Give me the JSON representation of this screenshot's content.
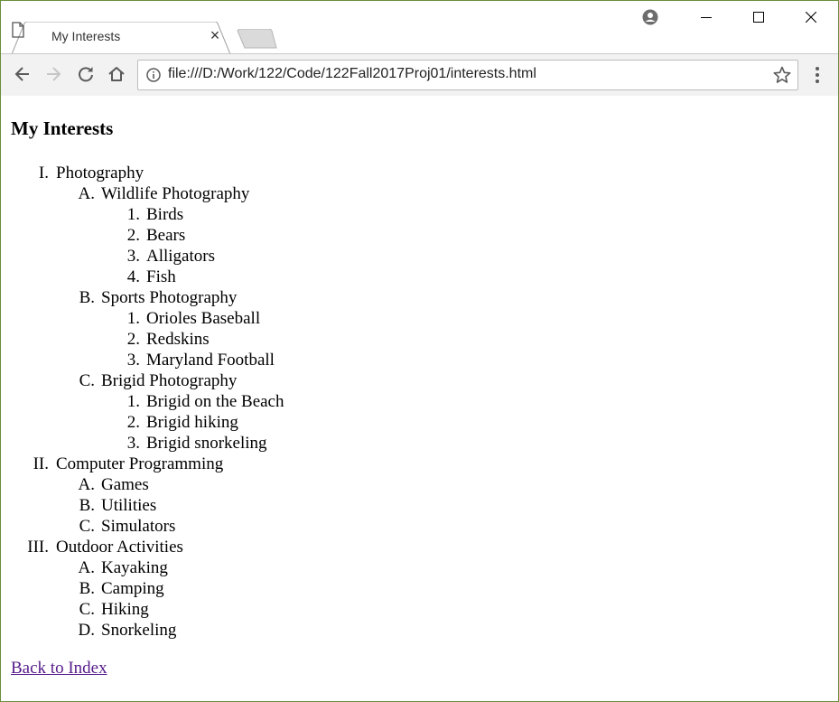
{
  "tab": {
    "title": "My Interests",
    "close_glyph": "×"
  },
  "address_bar": {
    "url": "file:///D:/Work/122/Code/122Fall2017Proj01/interests.html"
  },
  "page": {
    "heading": "My Interests",
    "outline": [
      {
        "marker": "I.",
        "label": "Photography",
        "children": [
          {
            "marker": "A.",
            "label": "Wildlife Photography",
            "children": [
              {
                "marker": "1.",
                "label": "Birds"
              },
              {
                "marker": "2.",
                "label": "Bears"
              },
              {
                "marker": "3.",
                "label": "Alligators"
              },
              {
                "marker": "4.",
                "label": "Fish"
              }
            ]
          },
          {
            "marker": "B.",
            "label": "Sports Photography",
            "children": [
              {
                "marker": "1.",
                "label": "Orioles Baseball"
              },
              {
                "marker": "2.",
                "label": "Redskins"
              },
              {
                "marker": "3.",
                "label": "Maryland Football"
              }
            ]
          },
          {
            "marker": "C.",
            "label": "Brigid Photography",
            "children": [
              {
                "marker": "1.",
                "label": "Brigid on the Beach"
              },
              {
                "marker": "2.",
                "label": "Brigid hiking"
              },
              {
                "marker": "3.",
                "label": "Brigid snorkeling"
              }
            ]
          }
        ]
      },
      {
        "marker": "II.",
        "label": "Computer Programming",
        "children": [
          {
            "marker": "A.",
            "label": "Games"
          },
          {
            "marker": "B.",
            "label": "Utilities"
          },
          {
            "marker": "C.",
            "label": "Simulators"
          }
        ]
      },
      {
        "marker": "III.",
        "label": "Outdoor Activities",
        "children": [
          {
            "marker": "A.",
            "label": "Kayaking"
          },
          {
            "marker": "B.",
            "label": "Camping"
          },
          {
            "marker": "C.",
            "label": "Hiking"
          },
          {
            "marker": "D.",
            "label": "Snorkeling"
          }
        ]
      }
    ],
    "back_link": "Back to Index"
  },
  "colors": {
    "link_visited": "#551a8b",
    "window_border": "#6a8f3a",
    "toolbar_bg": "#f2f2f2"
  },
  "icons": [
    "page-icon",
    "close-icon",
    "new-tab-icon",
    "profile-icon",
    "minimize-icon",
    "maximize-icon",
    "window-close-icon",
    "back-arrow-icon",
    "forward-arrow-icon",
    "reload-icon",
    "home-icon",
    "info-icon",
    "bookmark-star-icon",
    "menu-dots-icon"
  ]
}
